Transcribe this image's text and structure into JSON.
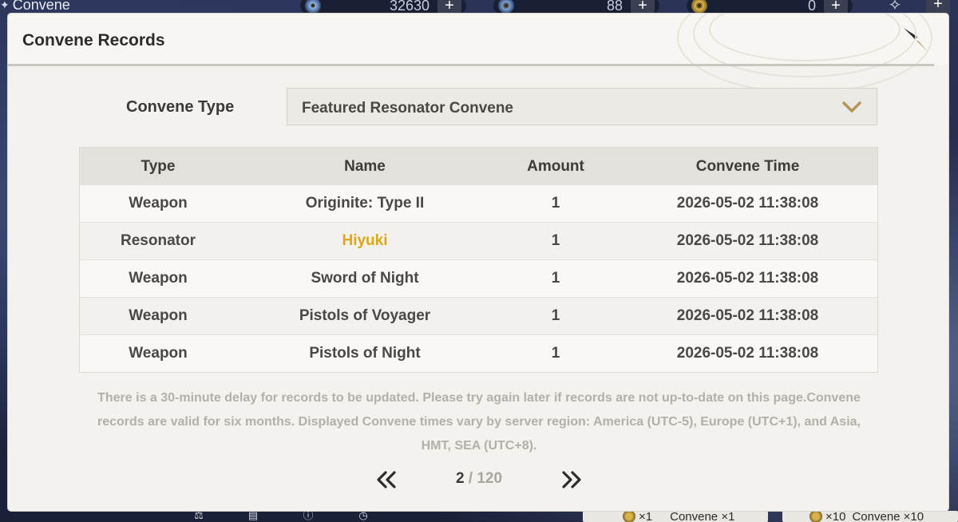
{
  "topbar": {
    "title": "Convene",
    "resources": [
      {
        "icon": "astrite-icon",
        "amount": "32630"
      },
      {
        "icon": "lustrous-tide-icon",
        "amount": "88"
      },
      {
        "icon": "radiant-tide-icon",
        "amount": "0"
      }
    ],
    "plus_label": "+"
  },
  "bottombar": {
    "convene_x1_label": "Convene ×1",
    "convene_x1_cost": "×1",
    "convene_x10_label": "Convene ×10",
    "convene_x10_cost": "×10"
  },
  "modal": {
    "title": "Convene Records",
    "type_label": "Convene Type",
    "selected_type": "Featured Resonator Convene",
    "columns": [
      "Type",
      "Name",
      "Amount",
      "Convene Time"
    ],
    "rows": [
      {
        "type": "Weapon",
        "name": "Originite: Type II",
        "amount": "1",
        "time": "2026-05-02 11:38:08",
        "highlight": false
      },
      {
        "type": "Resonator",
        "name": "Hiyuki",
        "amount": "1",
        "time": "2026-05-02 11:38:08",
        "highlight": true
      },
      {
        "type": "Weapon",
        "name": "Sword of Night",
        "amount": "1",
        "time": "2026-05-02 11:38:08",
        "highlight": false
      },
      {
        "type": "Weapon",
        "name": "Pistols of Voyager",
        "amount": "1",
        "time": "2026-05-02 11:38:08",
        "highlight": false
      },
      {
        "type": "Weapon",
        "name": "Pistols of Night",
        "amount": "1",
        "time": "2026-05-02 11:38:08",
        "highlight": false
      }
    ],
    "notice": "There is a 30-minute delay for records to be updated. Please try again later if records are not up-to-date on this page.Convene records are valid for six months. Displayed Convene times vary by server region: America (UTC-5), Europe (UTC+1), and Asia, HMT, SEA (UTC+8).",
    "pagination": {
      "current": "2",
      "separator": "/",
      "total": "120"
    }
  },
  "colors": {
    "highlight_gold": "#d9a916",
    "accent_gold": "#b4965a"
  }
}
